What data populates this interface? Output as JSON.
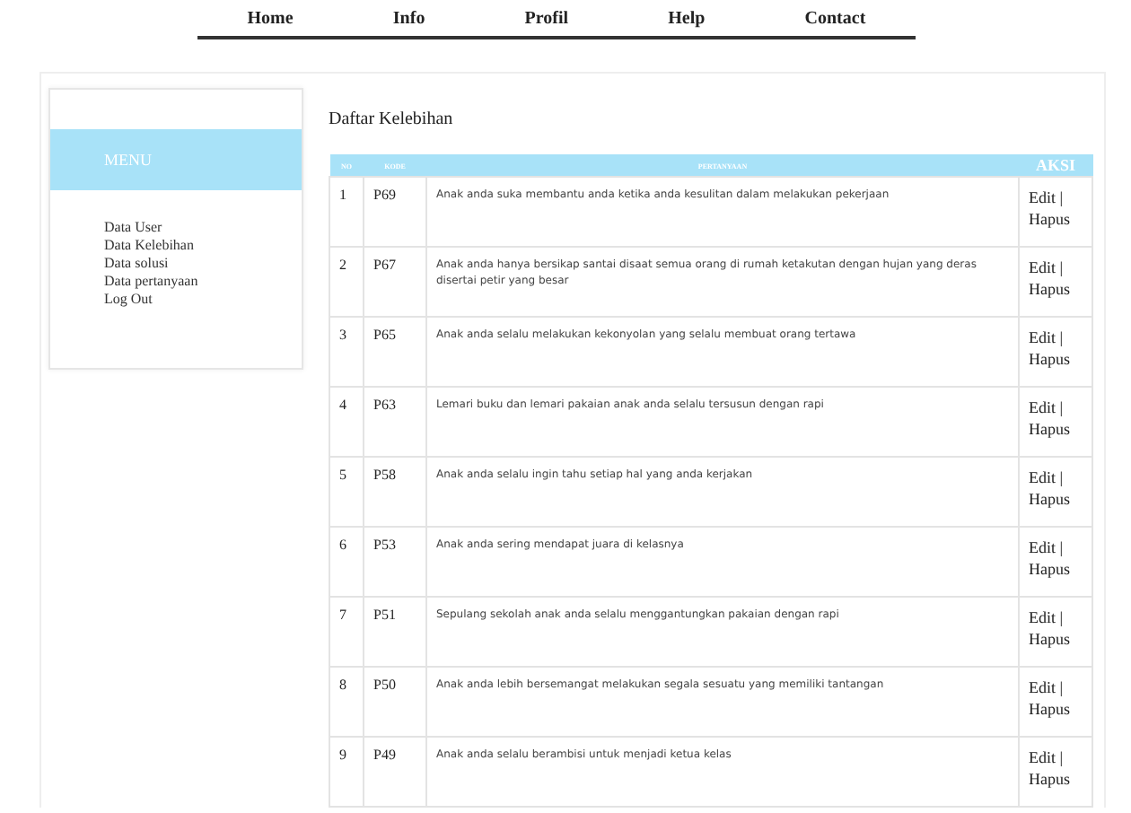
{
  "nav": [
    "Home",
    "Info",
    "Profil",
    "Help",
    "Contact"
  ],
  "sidebar": {
    "title": "MENU",
    "items": [
      "Data User",
      "Data Kelebihan",
      "Data solusi",
      "Data pertanyaan",
      "Log Out"
    ]
  },
  "content": {
    "title": "Daftar Kelebihan",
    "table": {
      "columns": [
        "NO",
        "KODE",
        "PERTANYAAN",
        "AKSI"
      ],
      "rows": [
        {
          "no": "1",
          "code": "P69",
          "question": "Anak anda suka membantu anda ketika anda kesulitan dalam melakukan pekerjaan",
          "edit": "Edit",
          "sep": "|",
          "delete": "Hapus"
        },
        {
          "no": "2",
          "code": "P67",
          "question": "Anak anda hanya bersikap santai disaat semua orang di rumah ketakutan dengan hujan yang deras disertai petir yang besar",
          "edit": "Edit",
          "sep": "|",
          "delete": "Hapus"
        },
        {
          "no": "3",
          "code": "P65",
          "question": "Anak anda selalu melakukan kekonyolan yang selalu membuat orang tertawa",
          "edit": "Edit",
          "sep": "|",
          "delete": "Hapus"
        },
        {
          "no": "4",
          "code": "P63",
          "question": "Lemari buku dan lemari pakaian anak anda selalu tersusun dengan rapi",
          "edit": "Edit",
          "sep": "|",
          "delete": "Hapus"
        },
        {
          "no": "5",
          "code": "P58",
          "question": "Anak anda selalu ingin tahu setiap hal yang anda kerjakan",
          "edit": "Edit",
          "sep": "|",
          "delete": "Hapus"
        },
        {
          "no": "6",
          "code": "P53",
          "question": "Anak anda sering mendapat juara di kelasnya",
          "edit": "Edit",
          "sep": "|",
          "delete": "Hapus"
        },
        {
          "no": "7",
          "code": "P51",
          "question": "Sepulang sekolah anak anda selalu menggantungkan pakaian dengan rapi",
          "edit": "Edit",
          "sep": "|",
          "delete": "Hapus"
        },
        {
          "no": "8",
          "code": "P50",
          "question": "Anak anda lebih bersemangat melakukan segala sesuatu  yang memiliki tantangan",
          "edit": "Edit",
          "sep": "|",
          "delete": "Hapus"
        },
        {
          "no": "9",
          "code": "P49",
          "question": "Anak anda selalu berambisi untuk menjadi ketua kelas",
          "edit": "Edit",
          "sep": "|",
          "delete": "Hapus"
        }
      ]
    }
  }
}
